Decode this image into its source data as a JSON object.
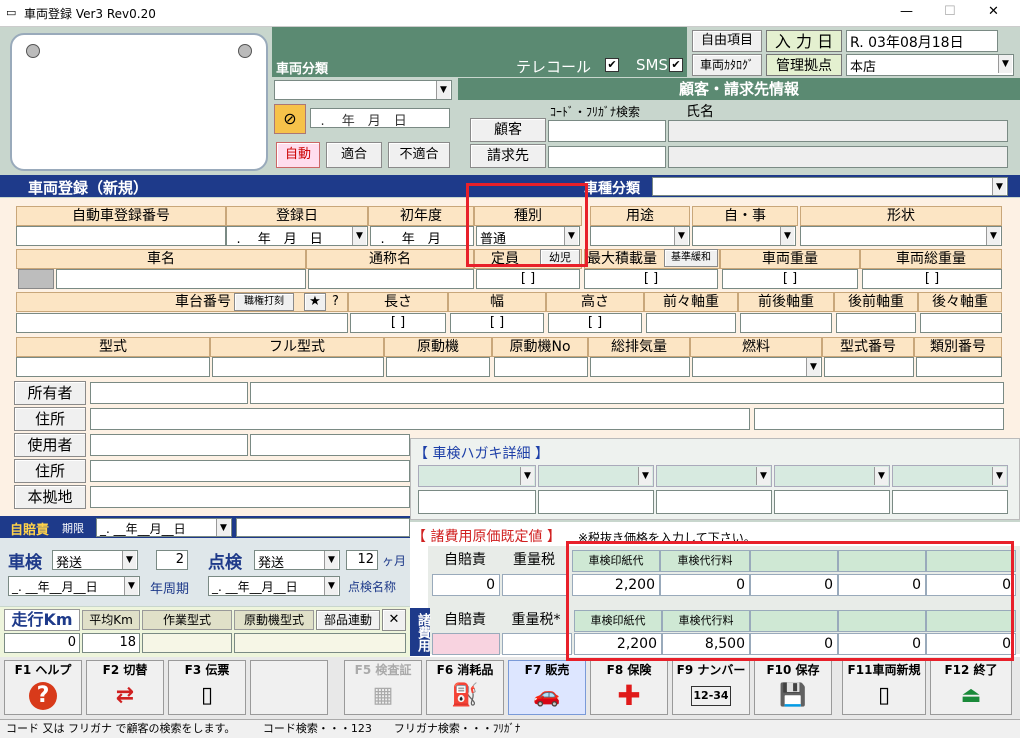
{
  "titlebar": {
    "title": "車両登録 Ver3 Rev0.20",
    "min": "—",
    "max": "☐",
    "close": "✕"
  },
  "top": {
    "free_item": "自由項目",
    "input_date_label": "入 力 日",
    "input_date": "R. 03年08月18日",
    "vehicle_catalog": "車両ｶﾀﾛｸﾞ",
    "base_label": "管理拠点",
    "base_value": "本店",
    "vehicle_class_label": "車両分類",
    "telecall_label": "テレコール",
    "sms_label": "SMS",
    "check": "✔"
  },
  "left": {
    "date_placeholder": "_. __年__月__日",
    "auto": "自動",
    "fit": "適合",
    "unfit": "不適合"
  },
  "customer": {
    "header": "顧客・請求先情報",
    "code_label": "ｺｰﾄﾞ・ﾌﾘｶﾞﾅ検索",
    "name_label": "氏名",
    "customer_btn": "顧客",
    "billing_btn": "請求先"
  },
  "bar": {
    "title": "車両登録（新規）",
    "type_label": "車種分類"
  },
  "row1": {
    "h_regno": "自動車登録番号",
    "h_regdate": "登録日",
    "h_firstyear": "初年度",
    "h_kind": "種別",
    "h_use": "用途",
    "h_private": "自・事",
    "h_shape": "形状",
    "regdate": "_. __年__月__日",
    "firstyear": "_. __年__月",
    "kind": "普通"
  },
  "row2": {
    "h_name": "車名",
    "h_common": "通称名",
    "h_capacity": "定員",
    "child": "幼児",
    "h_maxload": "最大積載量",
    "std_ease": "基準緩和",
    "h_weight": "車両重量",
    "h_gross": "車両総重量",
    "bracket": "[ ]"
  },
  "row3": {
    "h_chassis": "車台番号",
    "stamp": "職権打刻",
    "star": "★",
    "q": "?",
    "h_len": "長さ",
    "h_width": "幅",
    "h_height": "高さ",
    "h_ff": "前々軸重",
    "h_fr": "前後軸重",
    "h_rf": "後前軸重",
    "h_rr": "後々軸重"
  },
  "row4": {
    "h_model": "型式",
    "h_fullmodel": "フル型式",
    "h_engine": "原動機",
    "h_engine_no": "原動機No",
    "h_displacement": "総排気量",
    "h_fuel": "燃料",
    "h_modelno": "型式番号",
    "h_classno": "類別番号"
  },
  "persons": {
    "owner": "所有者",
    "address": "住所",
    "user": "使用者",
    "address2": "住所",
    "base": "本拠地"
  },
  "postcard": {
    "title": "【 車検ハガキ詳細 】"
  },
  "cost": {
    "title": "【 諸費用原価既定値 】",
    "note": "※税抜き価格を入力して下さい。",
    "h_jibai": "自賠責",
    "h_weight_tax": "重量税",
    "h_stamp": "車検印紙代",
    "h_agent": "車検代行料",
    "r1_jibai": "0",
    "r1_stamp": "2,200",
    "r1_agent": "0",
    "r1_z1": "0",
    "r1_z2": "0",
    "r1_z3": "0",
    "side": "諸費用",
    "r2_stamp": "2,200",
    "r2_agent": "8,500",
    "r2_z1": "0",
    "r2_z2": "0",
    "r2_z3": "0",
    "weight_tax_star": "重量税*"
  },
  "insp": {
    "jibai_label": "自賠責",
    "period": "期限",
    "date": "_. __年__月__日",
    "shaken": "車検",
    "shaken_mode": "発送",
    "cycle": "2",
    "cycle_unit": "年周期",
    "tenken": "点検",
    "tenken_mode": "発送",
    "months": "12",
    "month_unit": "ヶ月",
    "tenken_name": "点検名称"
  },
  "mileage": {
    "label": "走行Km",
    "avg_label": "平均Km",
    "work_model": "作業型式",
    "engine_model": "原動機型式",
    "parts_link": "部品連動",
    "close": "✕",
    "km": "0",
    "avg": "18"
  },
  "fkeys": [
    {
      "key": "F1",
      "label": "ヘルプ",
      "icon": "?"
    },
    {
      "key": "F2",
      "label": "切替",
      "icon": "⇄"
    },
    {
      "key": "F3",
      "label": "伝票",
      "icon": "▯"
    },
    {
      "key": "",
      "label": "",
      "icon": ""
    },
    {
      "key": "F5",
      "label": "検査証",
      "icon": "▦"
    },
    {
      "key": "F6",
      "label": "消耗品",
      "icon": "⛽"
    },
    {
      "key": "F7",
      "label": "販売",
      "icon": "🚗"
    },
    {
      "key": "F8",
      "label": "保険",
      "icon": "✚"
    },
    {
      "key": "F9",
      "label": "ナンバー",
      "icon": "12-34"
    },
    {
      "key": "F10",
      "label": "保存",
      "icon": "💾"
    },
    {
      "key": "F11",
      "label": "車両新規",
      "icon": "▯"
    },
    {
      "key": "F12",
      "label": "終了",
      "icon": "⏏"
    }
  ],
  "status": "コード 又は フリガナ で顧客の検索をします。　　　コード検索・・・123　　フリガナ検索・・・ﾌﾘｶﾞﾅ"
}
